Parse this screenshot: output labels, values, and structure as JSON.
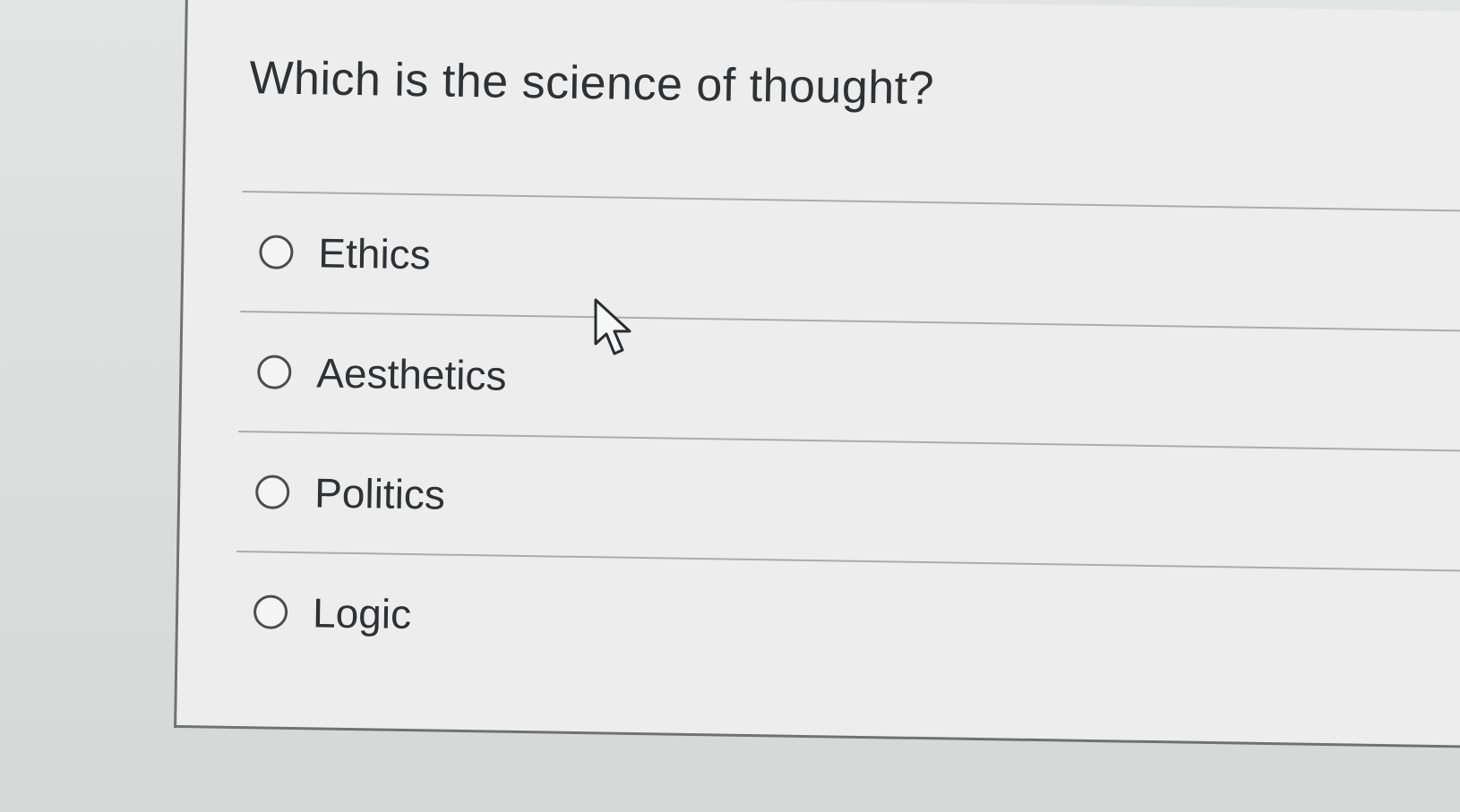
{
  "question": {
    "text": "Which is the science of thought?"
  },
  "options": [
    {
      "label": "Ethics",
      "selected": false
    },
    {
      "label": "Aesthetics",
      "selected": false
    },
    {
      "label": "Politics",
      "selected": false
    },
    {
      "label": "Logic",
      "selected": false
    }
  ],
  "icons": {
    "radio": "radio-button-unchecked",
    "cursor": "mouse-pointer-arrow"
  }
}
